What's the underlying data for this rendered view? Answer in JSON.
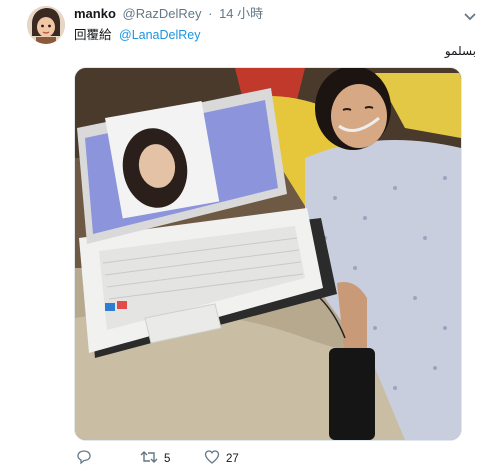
{
  "tweet": {
    "display_name": "manko",
    "handle": "@RazDelRey",
    "separator": "·",
    "time": "14 小時",
    "reply_prefix": "回覆給",
    "reply_to": "@LanaDelRey",
    "text": "بسلمو"
  },
  "actions": {
    "reply_icon": "reply-icon",
    "retweet_icon": "retweet-icon",
    "retweet_count": "5",
    "like_icon": "heart-icon",
    "like_count": "27"
  },
  "colors": {
    "link": "#1b95e0",
    "secondary_text": "#657786",
    "primary_text": "#14171a"
  }
}
